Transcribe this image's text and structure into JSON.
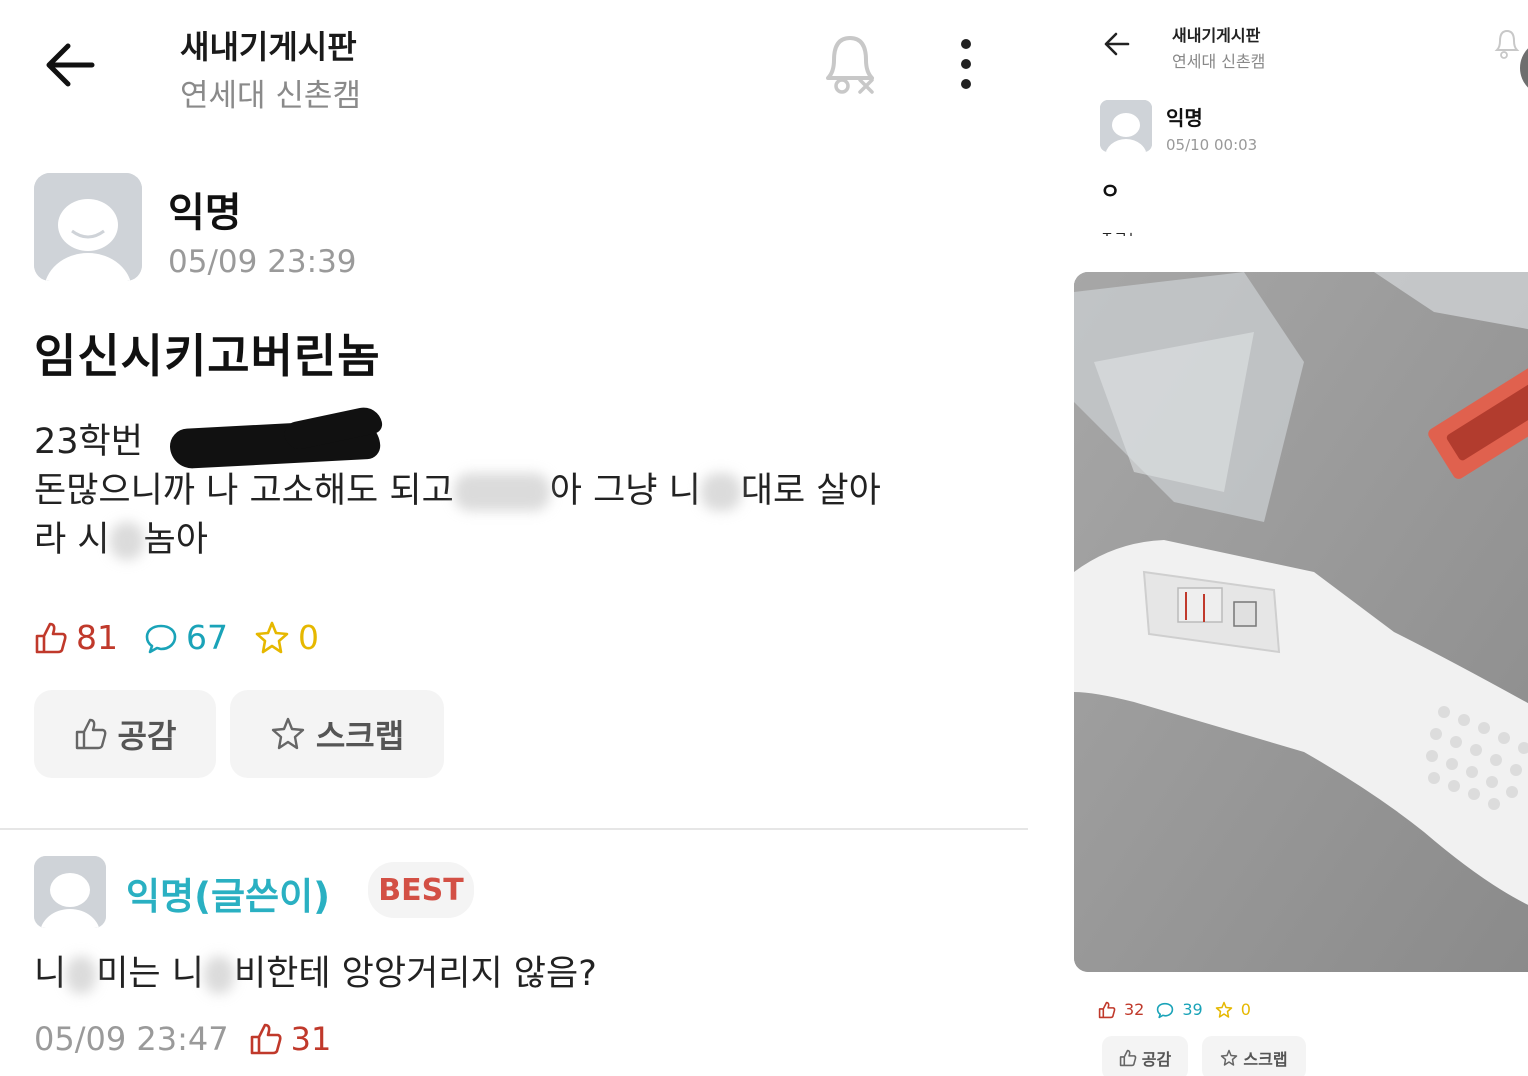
{
  "left": {
    "header": {
      "board_title": "새내기게시판",
      "board_subtitle": "연세대 신촌캠"
    },
    "post": {
      "author": "익명",
      "time": "05/09 23:39",
      "title": "임신시키고버린놈",
      "body_line1": "23학번",
      "body_line2_a": "돈많으니까 나 고소해도 되고",
      "body_line2_b": "아 그냥 니",
      "body_line2_c": "대로 살아",
      "body_line3_a": "라 시",
      "body_line3_b": "놈아",
      "likes": "81",
      "comments": "67",
      "scraps": "0"
    },
    "buttons": {
      "like_label": "공감",
      "scrap_label": "스크랩"
    },
    "comment": {
      "author": "익명(글쓴이)",
      "badge": "BEST",
      "text_a": "니",
      "text_b": "미는 니",
      "text_c": "비한테 앙앙거리지 않음?",
      "time": "05/09 23:47",
      "likes": "31"
    }
  },
  "right": {
    "header": {
      "board_title": "새내기게시판",
      "board_subtitle": "연세대 신촌캠"
    },
    "post": {
      "author": "익명",
      "time": "05/10 00:03",
      "title": "ㅇ",
      "body_cut": "ㅈㄱㄴ",
      "likes": "32",
      "comments": "39",
      "scraps": "0"
    },
    "buttons": {
      "like_label": "공감",
      "scrap_label": "스크랩"
    }
  },
  "colors": {
    "like": "#c0392b",
    "comment": "#1aa3b8",
    "scrap": "#e6b800",
    "author_op": "#2ab0c2",
    "best": "#d35045"
  },
  "icons": [
    "back-arrow-icon",
    "bell-off-icon",
    "more-vertical-icon",
    "thumbs-up-icon",
    "comment-bubble-icon",
    "star-icon"
  ]
}
